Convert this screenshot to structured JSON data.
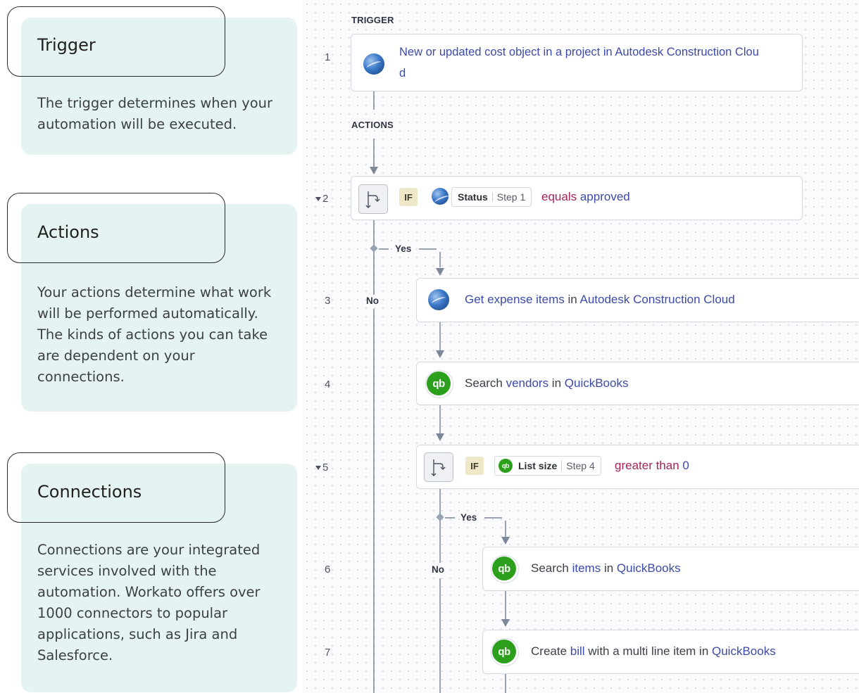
{
  "cards": [
    {
      "title": "Trigger",
      "body": "The trigger determines when your automation will be executed."
    },
    {
      "title": "Actions",
      "body": "Your actions determine what work will be performed automatically. The kinds of actions you can take are dependent on your connections."
    },
    {
      "title": "Connections",
      "body": "Connections are your integrated services involved with the automation. Workato offers over 1000 connectors to popular applications, such as Jira and Salesforce."
    }
  ],
  "sections": {
    "trigger": "TRIGGER",
    "actions": "ACTIONS"
  },
  "branch": {
    "yes": "Yes",
    "no": "No",
    "if": "IF"
  },
  "step1": {
    "num": "1",
    "line1": "New or updated cost object in a project in Autodesk Construction Clou",
    "line2": "d",
    "app": "autodesk-globe-icon"
  },
  "step2": {
    "num": "2",
    "field": "Status",
    "ref": "Step 1",
    "operator": "equals",
    "value": "approved"
  },
  "step3": {
    "num": "3",
    "t1": "Get expense items",
    "t2": " in ",
    "t3": "Autodesk Construction Cloud"
  },
  "step4": {
    "num": "4",
    "t1": "Search ",
    "t2": "vendors",
    "t3": " in ",
    "t4": "QuickBooks"
  },
  "step5": {
    "num": "5",
    "field": "List size",
    "ref": "Step 4",
    "operator": "greater than",
    "value": "0"
  },
  "step6": {
    "num": "6",
    "t1": "Search ",
    "t2": "items",
    "t3": " in ",
    "t4": "QuickBooks"
  },
  "step7": {
    "num": "7",
    "t1": "Create ",
    "t2": "bill",
    "t3": " with a multi line item in ",
    "t4": "QuickBooks"
  },
  "icons": {
    "qb_text": "qb"
  },
  "colors": {
    "card_bg": "#e6f3f3",
    "link": "#3c4aa8",
    "operator": "#a6225a",
    "quickbooks": "#2ca01c",
    "if_badge": "#efe8c8"
  }
}
